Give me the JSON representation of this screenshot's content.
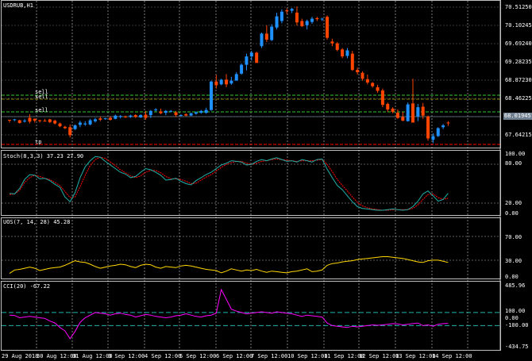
{
  "colors": {
    "background": "#000000",
    "bull": "#1e90ff",
    "bear": "#ff4500",
    "grid": "#ffffff",
    "axis_text": "#ffffff",
    "level_sell": "#32cd32",
    "level_sell2": "#808000",
    "level_tp": "#ff0000",
    "current_price_bg": "#708090",
    "stoch_main": "#20b2aa",
    "stoch_signal": "#ff0000",
    "uos_line": "#ffd700",
    "cci_line": "#ff00ff",
    "cci_levels": "#20b2aa"
  },
  "main": {
    "symbol_label": "USDRUB,H1",
    "price_ticks": [
      "70.51250",
      "70.10245",
      "69.69240",
      "69.28235",
      "68.87230",
      "68.46225",
      "68.05220",
      "67.64215"
    ],
    "current_price": "68.01945",
    "level_labels": {
      "sell1": "sell",
      "sell2": "sell",
      "sell3": "sell",
      "tp": "tp"
    }
  },
  "stoch": {
    "label": "Stoch(8,3,3) 37.23 27.90",
    "ticks": [
      "100.00",
      "80.00",
      "20.00",
      "0.00"
    ]
  },
  "uos": {
    "label": "UOS(7, 14, 28) 45.28",
    "ticks": [
      "70.00",
      "30.00",
      "0.00"
    ]
  },
  "cci": {
    "label": "CCI(20) -67.22",
    "ticks": [
      "485.96",
      "100.00",
      "0.00",
      "-100.00",
      "-434.75"
    ]
  },
  "time_axis": [
    "29 Aug 2018",
    "30 Aug 12:00",
    "31 Aug 12:00",
    "3 Sep 12:00",
    "4 Sep 12:00",
    "5 Sep 12:00",
    "6 Sep 12:00",
    "7 Sep 12:00",
    "10 Sep 12:00",
    "11 Sep 12:00",
    "12 Sep 12:00",
    "13 Sep 12:00",
    "14 Sep 12:00"
  ],
  "candles": [
    [
      68.08,
      68.07,
      68.02,
      68.07
    ],
    [
      68.08,
      68.1,
      68.05,
      68.09
    ],
    [
      68.07,
      68.08,
      68.0,
      68.01
    ],
    [
      68.05,
      68.1,
      68.02,
      68.06
    ],
    [
      68.12,
      68.2,
      68.0,
      68.04
    ],
    [
      68.1,
      68.11,
      68.02,
      68.06
    ],
    [
      68.07,
      68.08,
      68.02,
      68.06
    ],
    [
      68.06,
      68.1,
      68.04,
      68.05
    ],
    [
      68.09,
      68.1,
      68.01,
      68.03
    ],
    [
      68.06,
      68.08,
      67.98,
      68.0
    ],
    [
      68.0,
      68.02,
      67.92,
      67.94
    ],
    [
      67.93,
      67.95,
      67.88,
      67.9
    ],
    [
      67.92,
      67.98,
      67.7,
      67.75
    ],
    [
      67.88,
      67.98,
      67.86,
      67.96
    ],
    [
      67.97,
      68.06,
      67.92,
      68.02
    ],
    [
      67.98,
      68.05,
      67.95,
      68.0
    ],
    [
      67.98,
      68.1,
      67.96,
      68.07
    ],
    [
      68.05,
      68.12,
      68.02,
      68.09
    ],
    [
      68.11,
      68.15,
      68.05,
      68.08
    ],
    [
      68.1,
      68.12,
      68.08,
      68.11
    ],
    [
      68.12,
      68.16,
      68.06,
      68.08
    ],
    [
      68.1,
      68.19,
      68.09,
      68.17
    ],
    [
      68.14,
      68.18,
      68.11,
      68.16
    ],
    [
      68.15,
      68.17,
      68.12,
      68.14
    ],
    [
      68.14,
      68.19,
      68.12,
      68.17
    ],
    [
      68.18,
      68.2,
      68.12,
      68.14
    ],
    [
      68.13,
      68.2,
      68.12,
      68.18
    ],
    [
      68.19,
      68.27,
      68.08,
      68.12
    ],
    [
      68.18,
      68.29,
      68.12,
      68.27
    ],
    [
      68.29,
      68.33,
      68.26,
      68.3
    ],
    [
      68.26,
      68.32,
      68.2,
      68.22
    ],
    [
      68.23,
      68.29,
      68.18,
      68.27
    ],
    [
      68.26,
      68.29,
      68.24,
      68.27
    ],
    [
      68.24,
      68.27,
      68.14,
      68.18
    ],
    [
      68.17,
      68.2,
      68.15,
      68.18
    ],
    [
      68.2,
      68.22,
      68.16,
      68.17
    ],
    [
      68.17,
      68.23,
      68.16,
      68.22
    ],
    [
      68.21,
      68.26,
      68.19,
      68.24
    ],
    [
      68.23,
      68.29,
      68.21,
      68.27
    ],
    [
      68.23,
      68.34,
      68.21,
      68.29
    ],
    [
      68.29,
      68.92,
      68.27,
      68.9
    ],
    [
      68.9,
      69.04,
      68.75,
      68.82
    ],
    [
      68.84,
      68.96,
      68.82,
      68.94
    ],
    [
      68.94,
      69.06,
      68.78,
      68.84
    ],
    [
      68.86,
      69.0,
      68.83,
      68.92
    ],
    [
      68.92,
      69.1,
      68.92,
      69.06
    ],
    [
      69.07,
      69.29,
      69.05,
      69.26
    ],
    [
      69.26,
      69.5,
      69.14,
      69.44
    ],
    [
      69.44,
      69.56,
      69.35,
      69.52
    ],
    [
      69.52,
      69.54,
      69.44,
      69.3
    ],
    [
      69.66,
      69.95,
      69.62,
      69.93
    ],
    [
      69.93,
      70.11,
      69.75,
      69.8
    ],
    [
      69.79,
      70.13,
      69.77,
      70.08
    ],
    [
      70.06,
      70.38,
      70.02,
      70.3
    ],
    [
      70.2,
      70.45,
      70.15,
      70.4
    ],
    [
      70.43,
      70.47,
      70.35,
      70.41
    ],
    [
      70.42,
      70.48,
      70.37,
      70.46
    ],
    [
      70.38,
      70.51,
      70.1,
      70.17
    ],
    [
      70.2,
      70.25,
      70.07,
      70.09
    ],
    [
      70.11,
      70.23,
      70.02,
      70.2
    ],
    [
      70.18,
      70.29,
      70.14,
      70.25
    ],
    [
      70.26,
      70.29,
      70.2,
      70.24
    ],
    [
      70.24,
      70.27,
      70.2,
      70.25
    ],
    [
      70.29,
      70.32,
      69.8,
      69.84
    ],
    [
      69.76,
      69.82,
      69.66,
      69.72
    ],
    [
      69.72,
      69.75,
      69.55,
      69.58
    ],
    [
      69.59,
      69.62,
      69.4,
      69.44
    ],
    [
      69.45,
      69.62,
      69.4,
      69.57
    ],
    [
      69.5,
      69.56,
      69.13,
      69.15
    ],
    [
      69.15,
      69.2,
      69.05,
      69.1
    ],
    [
      69.09,
      69.12,
      68.92,
      68.96
    ],
    [
      68.95,
      69.05,
      68.84,
      68.88
    ],
    [
      68.87,
      68.89,
      68.77,
      68.8
    ],
    [
      68.78,
      68.83,
      68.66,
      68.7
    ],
    [
      68.71,
      68.75,
      68.35,
      68.4
    ],
    [
      68.42,
      68.45,
      68.25,
      68.3
    ],
    [
      68.32,
      68.35,
      68.22,
      68.25
    ],
    [
      68.23,
      68.3,
      68.1,
      68.12
    ],
    [
      68.14,
      68.25,
      68.05,
      68.06
    ],
    [
      68.05,
      68.45,
      68.04,
      68.41
    ],
    [
      68.43,
      68.96,
      68.36,
      68.02
    ],
    [
      68.15,
      68.42,
      68.05,
      68.35
    ],
    [
      68.36,
      68.44,
      68.1,
      68.17
    ],
    [
      68.15,
      68.17,
      67.63,
      67.68
    ],
    [
      67.65,
      67.79,
      67.58,
      67.73
    ],
    [
      67.73,
      67.92,
      67.71,
      67.9
    ],
    [
      67.92,
      67.99,
      67.88,
      67.96
    ],
    [
      68.02,
      68.05,
      67.95,
      68.01
    ]
  ],
  "stoch_main": [
    32,
    31,
    40,
    55,
    63,
    62,
    56,
    57,
    53,
    47,
    42,
    26,
    18,
    33,
    58,
    76,
    86,
    93,
    92,
    85,
    79,
    73,
    67,
    64,
    58,
    60,
    67,
    73,
    71,
    67,
    62,
    54,
    55,
    57,
    52,
    48,
    46,
    53,
    58,
    63,
    67,
    73,
    79,
    82,
    86,
    85,
    84,
    79,
    80,
    85,
    88,
    86,
    89,
    91,
    88,
    85,
    86,
    84,
    88,
    86,
    84,
    88,
    89,
    72,
    58,
    45,
    38,
    28,
    18,
    10,
    7,
    6,
    5,
    4,
    4,
    5,
    6,
    5,
    4,
    5,
    10,
    19,
    31,
    36,
    28,
    19,
    22,
    32
  ],
  "stoch_signal": [
    30,
    31,
    37,
    50,
    58,
    62,
    60,
    57,
    55,
    50,
    45,
    35,
    25,
    26,
    43,
    62,
    78,
    88,
    92,
    90,
    84,
    78,
    71,
    66,
    61,
    58,
    61,
    67,
    70,
    70,
    66,
    60,
    56,
    56,
    55,
    52,
    48,
    49,
    54,
    59,
    63,
    69,
    75,
    80,
    83,
    85,
    85,
    82,
    80,
    82,
    85,
    86,
    88,
    89,
    88,
    87,
    86,
    85,
    86,
    86,
    86,
    87,
    88,
    80,
    68,
    55,
    45,
    36,
    26,
    17,
    11,
    8,
    6,
    5,
    4,
    4,
    5,
    5,
    5,
    5,
    7,
    13,
    22,
    30,
    31,
    25,
    22,
    24
  ],
  "uos_values": [
    64,
    58,
    57,
    55,
    53,
    55,
    59,
    57,
    55,
    54,
    53,
    50,
    46,
    42,
    44,
    45,
    48,
    52,
    55,
    53,
    51,
    50,
    48,
    49,
    52,
    54,
    50,
    48,
    49,
    53,
    55,
    52,
    53,
    54,
    51,
    50,
    51,
    53,
    55,
    57,
    58,
    59,
    63,
    60,
    56,
    58,
    60,
    58,
    59,
    57,
    60,
    62,
    60,
    61,
    62,
    63,
    61,
    60,
    58,
    56,
    61,
    60,
    58,
    50,
    47,
    46,
    44,
    43,
    42,
    40,
    39,
    38,
    37,
    36,
    35,
    35,
    36,
    37,
    38,
    40,
    42,
    44,
    45,
    42,
    41,
    41,
    43,
    45
  ],
  "cci_values": [
    60,
    55,
    20,
    30,
    40,
    30,
    20,
    10,
    -30,
    -60,
    -130,
    -180,
    -300,
    -190,
    -50,
    20,
    60,
    100,
    90,
    80,
    60,
    80,
    90,
    70,
    60,
    30,
    50,
    70,
    60,
    40,
    30,
    20,
    30,
    50,
    60,
    80,
    60,
    40,
    30,
    50,
    60,
    90,
    450,
    300,
    150,
    120,
    100,
    80,
    90,
    100,
    110,
    100,
    90,
    110,
    100,
    90,
    80,
    60,
    40,
    60,
    50,
    40,
    30,
    -60,
    -100,
    -110,
    -120,
    -130,
    -110,
    -120,
    -110,
    -100,
    -90,
    -95,
    -90,
    -80,
    -70,
    -75,
    -90,
    -80,
    -70,
    -60,
    -100,
    -90,
    -110,
    -80,
    -70,
    -67
  ]
}
